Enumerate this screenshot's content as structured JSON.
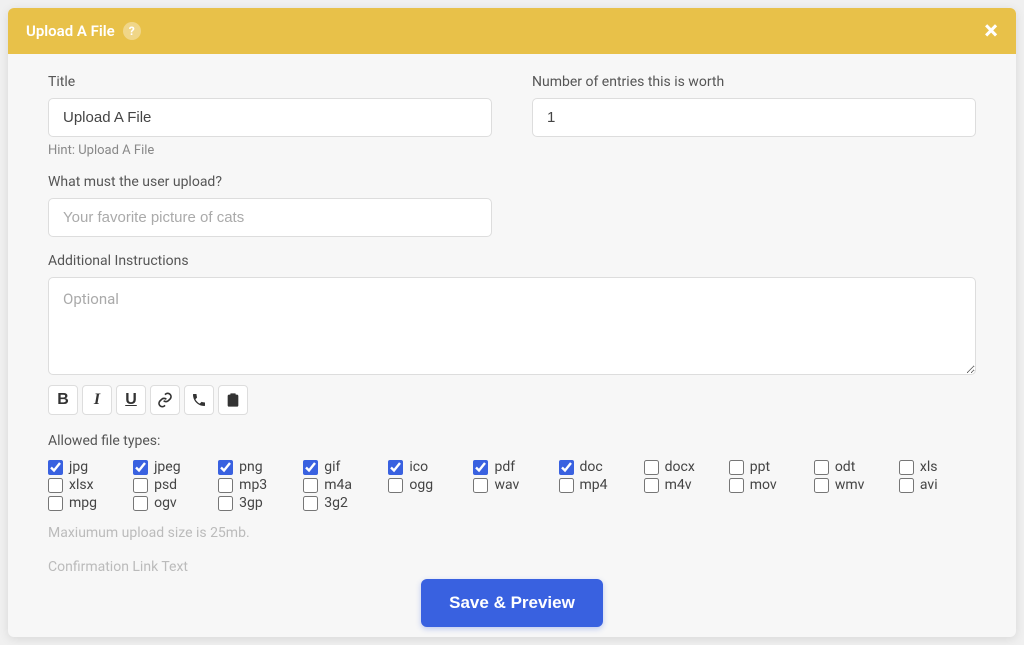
{
  "header": {
    "title": "Upload A File"
  },
  "fields": {
    "title_label": "Title",
    "title_value": "Upload A File",
    "title_hint": "Hint: Upload A File",
    "entries_label": "Number of entries this is worth",
    "entries_value": "1",
    "upload_label": "What must the user upload?",
    "upload_placeholder": "Your favorite picture of cats",
    "instructions_label": "Additional Instructions",
    "instructions_placeholder": "Optional"
  },
  "toolbar": {
    "bold": "B",
    "italic": "I",
    "underline": "U"
  },
  "filetypes": {
    "label": "Allowed file types:",
    "items": [
      {
        "name": "jpg",
        "checked": true
      },
      {
        "name": "jpeg",
        "checked": true
      },
      {
        "name": "png",
        "checked": true
      },
      {
        "name": "gif",
        "checked": true
      },
      {
        "name": "ico",
        "checked": true
      },
      {
        "name": "pdf",
        "checked": true
      },
      {
        "name": "doc",
        "checked": true
      },
      {
        "name": "docx",
        "checked": false
      },
      {
        "name": "ppt",
        "checked": false
      },
      {
        "name": "odt",
        "checked": false
      },
      {
        "name": "xls",
        "checked": false
      },
      {
        "name": "xlsx",
        "checked": false
      },
      {
        "name": "psd",
        "checked": false
      },
      {
        "name": "mp3",
        "checked": false
      },
      {
        "name": "m4a",
        "checked": false
      },
      {
        "name": "ogg",
        "checked": false
      },
      {
        "name": "wav",
        "checked": false
      },
      {
        "name": "mp4",
        "checked": false
      },
      {
        "name": "m4v",
        "checked": false
      },
      {
        "name": "mov",
        "checked": false
      },
      {
        "name": "wmv",
        "checked": false
      },
      {
        "name": "avi",
        "checked": false
      },
      {
        "name": "mpg",
        "checked": false
      },
      {
        "name": "ogv",
        "checked": false
      },
      {
        "name": "3gp",
        "checked": false
      },
      {
        "name": "3g2",
        "checked": false
      }
    ]
  },
  "footer": {
    "max_size": "Maxiumum upload size is 25mb.",
    "confirm_label": "Confirmation Link Text",
    "save_button": "Save & Preview"
  }
}
